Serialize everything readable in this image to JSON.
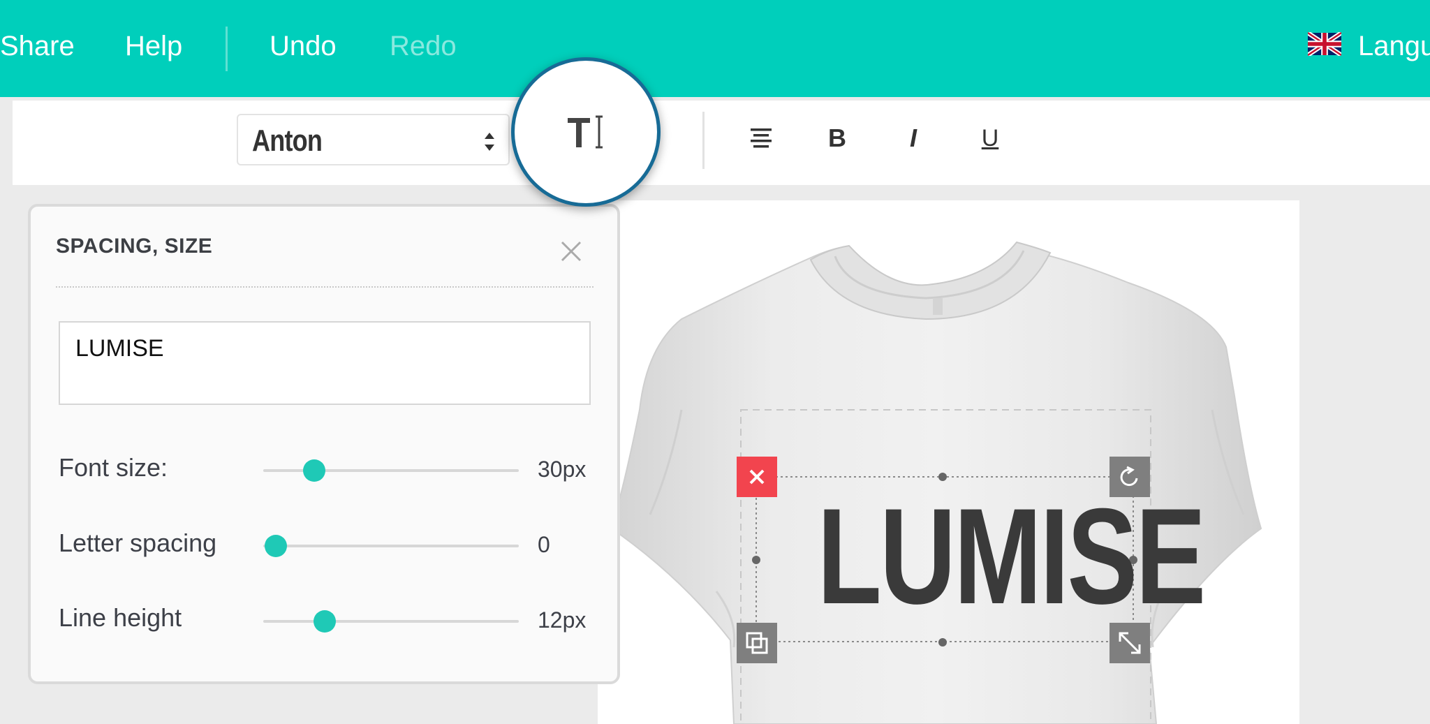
{
  "topbar": {
    "share_label": "Share",
    "help_label": "Help",
    "undo_label": "Undo",
    "redo_label": "Redo",
    "language_label": "Langu",
    "flag_icon": "uk-flag-icon",
    "background_color": "#00cfbb"
  },
  "toolbar": {
    "font_family_value": "Anton",
    "text_tool_icon": "text-cursor-icon",
    "align_icon": "align-justify-icon",
    "bold_label": "B",
    "italic_label": "I",
    "underline_label": "U"
  },
  "panel": {
    "title": "SPACING, SIZE",
    "text_value": "LUMISE",
    "font_size": {
      "label": "Font size:",
      "value": "30px",
      "level": 0.2
    },
    "letter_spacing": {
      "label": "Letter spacing",
      "value": "0",
      "level": 0.05
    },
    "line_height": {
      "label": "Line height",
      "value": "12px",
      "level": 0.24
    }
  },
  "canvas": {
    "design_text": "LUMISE",
    "accent_color": "#1fc9b6",
    "delete_color": "#f2444e"
  }
}
